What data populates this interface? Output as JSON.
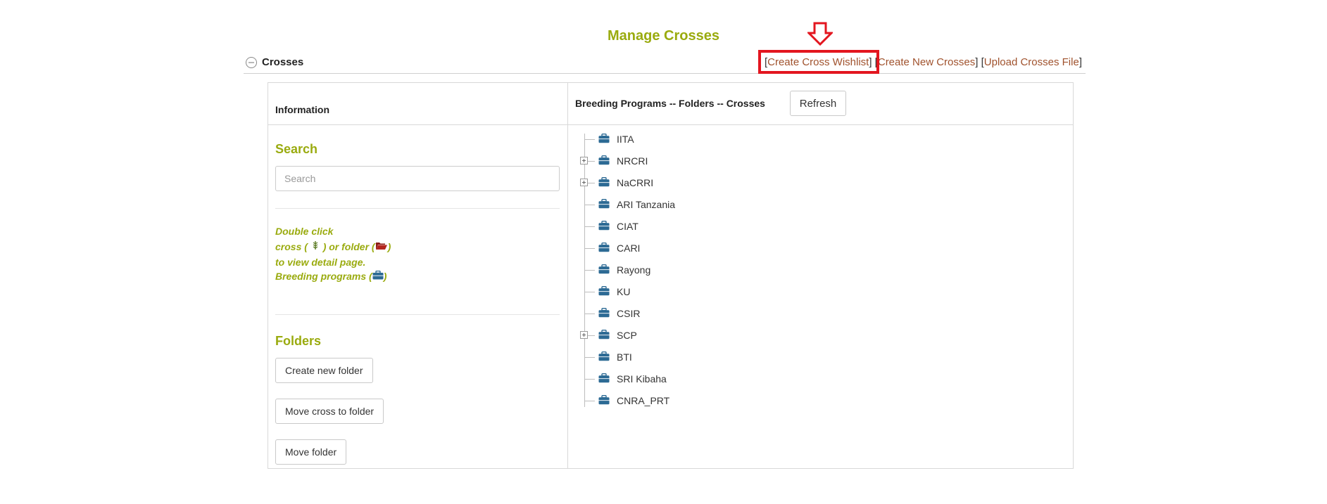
{
  "page": {
    "title": "Manage Crosses"
  },
  "section": {
    "title": "Crosses",
    "links": [
      {
        "label": "Create Cross Wishlist"
      },
      {
        "label": "Create New Crosses"
      },
      {
        "label": "Upload Crosses File"
      }
    ]
  },
  "info_panel": {
    "title": "Information",
    "search": {
      "heading": "Search",
      "placeholder": "Search"
    },
    "help": {
      "line1": "Double click",
      "line2a": "cross (",
      "line2b": ") or folder (",
      "line2c": ")",
      "line3": "to view detail page.",
      "line4a": "Breeding programs (",
      "line4b": ")"
    },
    "folders": {
      "heading": "Folders",
      "create_label": "Create new folder",
      "move_cross_label": "Move cross to folder",
      "move_folder_label": "Move folder"
    }
  },
  "tree_panel": {
    "title": "Breeding Programs -- Folders -- Crosses",
    "refresh_label": "Refresh",
    "programs": [
      {
        "name": "IITA",
        "expandable": false
      },
      {
        "name": "NRCRI",
        "expandable": true
      },
      {
        "name": "NaCRRI",
        "expandable": true
      },
      {
        "name": "ARI Tanzania",
        "expandable": false
      },
      {
        "name": "CIAT",
        "expandable": false
      },
      {
        "name": "CARI",
        "expandable": false
      },
      {
        "name": "Rayong",
        "expandable": false
      },
      {
        "name": "KU",
        "expandable": false
      },
      {
        "name": "CSIR",
        "expandable": false
      },
      {
        "name": "SCP",
        "expandable": true
      },
      {
        "name": "BTI",
        "expandable": false
      },
      {
        "name": "SRI Kibaha",
        "expandable": false
      },
      {
        "name": "CNRA_PRT",
        "expandable": false
      }
    ]
  },
  "colors": {
    "accent_green": "#9aab0f",
    "link_brown": "#a0522d",
    "highlight_red": "#e3161f",
    "briefcase_blue": "#2c6a94",
    "folder_red": "#b3261e"
  },
  "icons": [
    "down-arrow-icon",
    "collapse-minus-icon",
    "cross-plant-icon",
    "folder-open-icon",
    "briefcase-icon",
    "expand-plus-icon"
  ]
}
